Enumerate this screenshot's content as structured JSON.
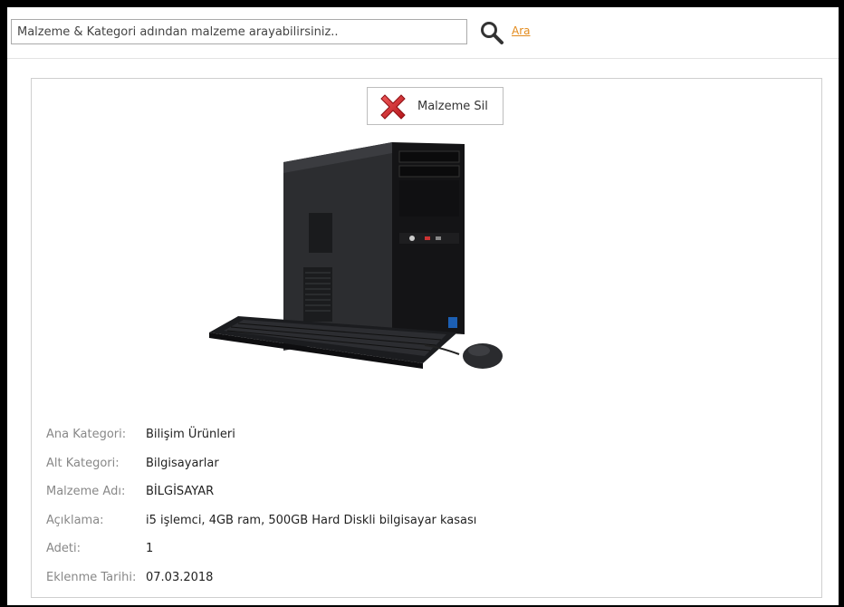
{
  "search": {
    "placeholder": "Malzeme & Kategori adından malzeme arayabilirsiniz..",
    "button_label": "Ara"
  },
  "item": {
    "delete_label": "Malzeme Sil",
    "details": [
      {
        "label": "Ana Kategori:",
        "value": "Bilişim Ürünleri"
      },
      {
        "label": "Alt Kategori:",
        "value": "Bilgisayarlar"
      },
      {
        "label": "Malzeme Adı:",
        "value": "BİLGİSAYAR"
      },
      {
        "label": "Açıklama:",
        "value": "i5 işlemci, 4GB ram, 500GB Hard Diskli bilgisayar kasası"
      },
      {
        "label": "Adeti:",
        "value": "1"
      },
      {
        "label": "Eklenme Tarihi:",
        "value": "07.03.2018"
      }
    ]
  },
  "colors": {
    "link": "#e38a1b",
    "delete_icon": "#d9262b"
  },
  "icons": {
    "search": "search-icon",
    "delete": "red-x-icon",
    "product": "desktop-computer-image"
  }
}
